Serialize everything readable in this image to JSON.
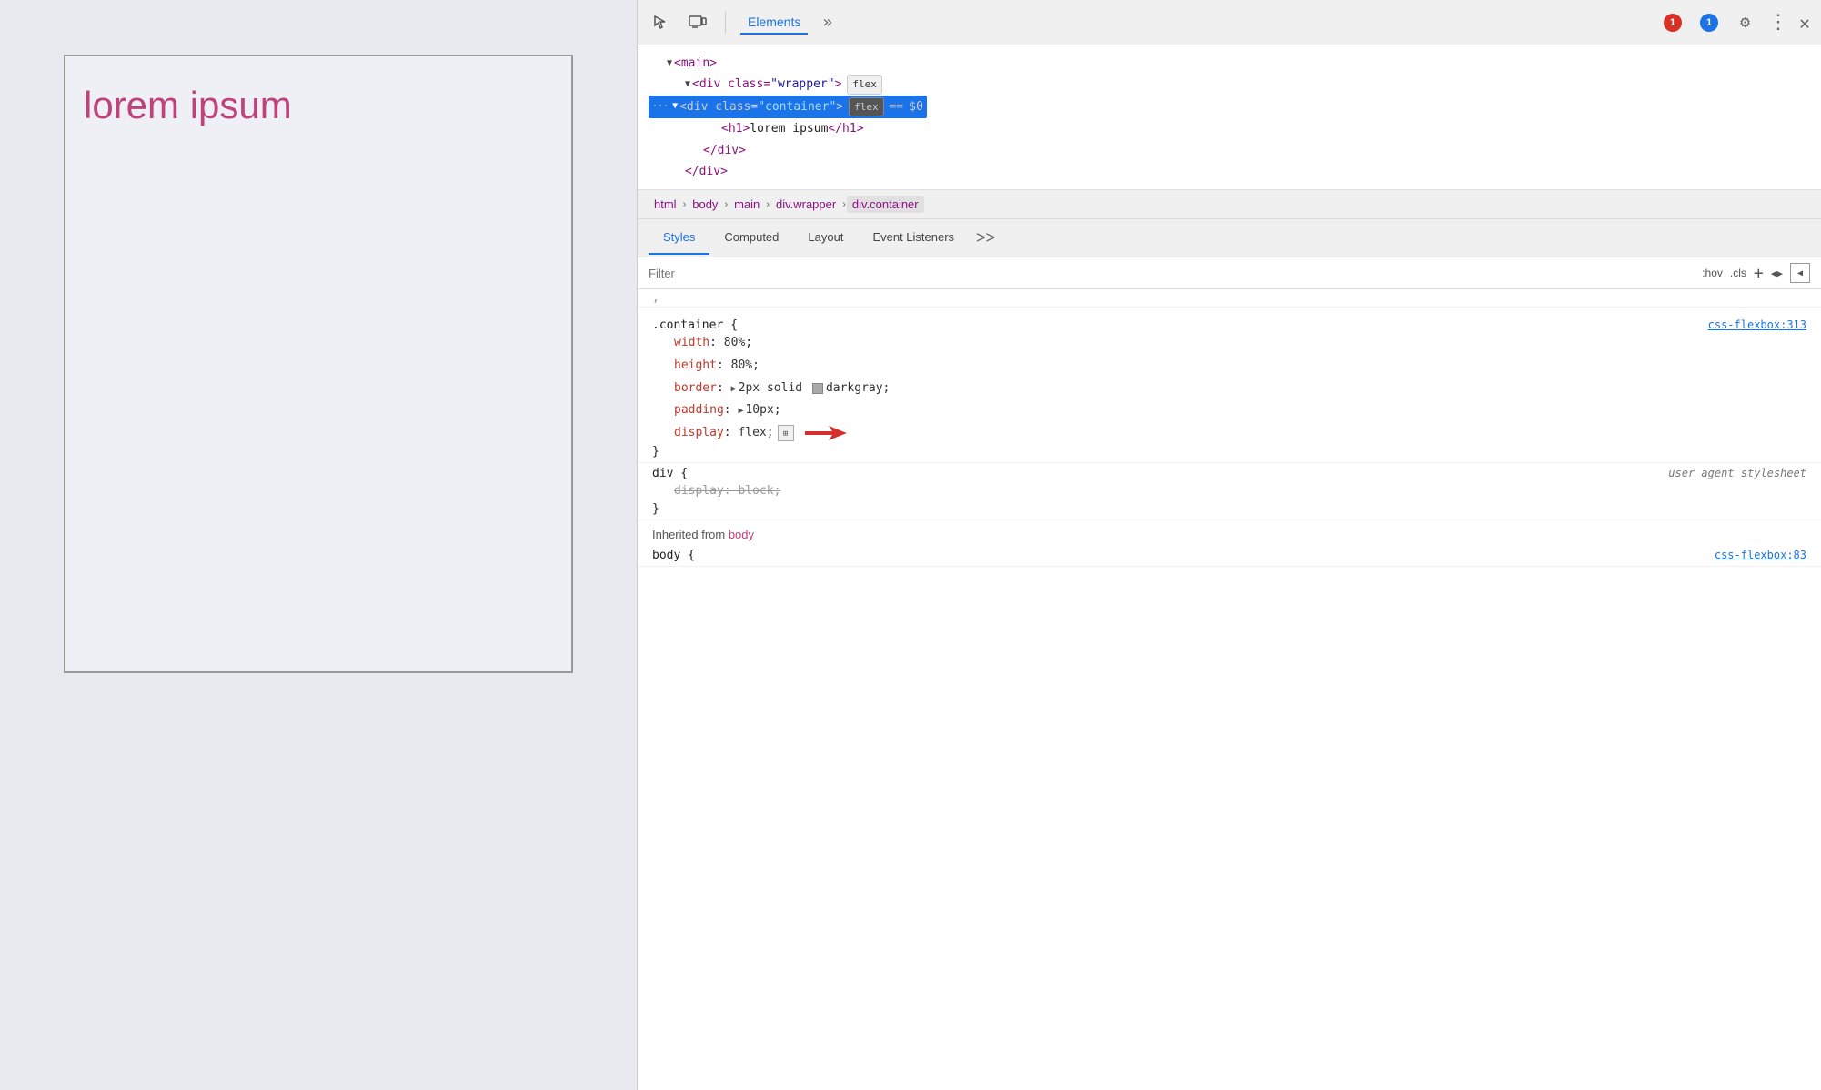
{
  "preview": {
    "lorem_text": "lorem ipsum"
  },
  "devtools": {
    "toolbar": {
      "inspect_icon": "⬚",
      "device_icon": "▭",
      "elements_label": "Elements",
      "more_icon": "»",
      "error_count": "1",
      "info_count": "1",
      "gear_icon": "⚙",
      "dots_icon": "⋮",
      "close_icon": "✕"
    },
    "dom_tree": {
      "main_open": "<main>",
      "wrapper_open": "<div class=\"wrapper\">",
      "wrapper_badge": "flex",
      "container_open": "<div class=\"container\">",
      "container_badge": "flex",
      "eq_sign": "==",
      "dollar_zero": "$0",
      "h1_open": "<h1>lorem ipsum</h1>",
      "div_close": "</div>",
      "div_close2": "</div>"
    },
    "breadcrumb": {
      "items": [
        "html",
        "body",
        "main",
        "div.wrapper",
        "div.container"
      ]
    },
    "tabs": {
      "styles": "Styles",
      "computed": "Computed",
      "layout": "Layout",
      "event_listeners": "Event Listeners",
      "more": ">>"
    },
    "filter": {
      "placeholder": "Filter",
      "hov": ":hov",
      "cls": ".cls",
      "plus": "+",
      "collapse": "◀"
    },
    "css_rules": {
      "container_rule": {
        "selector": ".container {",
        "source": "css-flexbox:313",
        "props": [
          {
            "name": "width",
            "value": "80%;"
          },
          {
            "name": "height",
            "value": "80%;"
          },
          {
            "name": "border",
            "value": "2px solid",
            "has_swatch": true,
            "swatch_color": "#a9a9a9",
            "extra": "darkgray;"
          },
          {
            "name": "padding",
            "value": "10px;",
            "has_triangle": true
          },
          {
            "name": "display",
            "value": "flex;",
            "has_flex_icon": true,
            "has_arrow": true
          }
        ],
        "close": "}"
      },
      "div_rule": {
        "selector": "div {",
        "source_label": "user agent stylesheet",
        "props": [
          {
            "name": "display: block;",
            "strikethrough": true
          }
        ],
        "close": "}"
      }
    },
    "inherited": {
      "label": "Inherited from",
      "source": "body"
    }
  }
}
